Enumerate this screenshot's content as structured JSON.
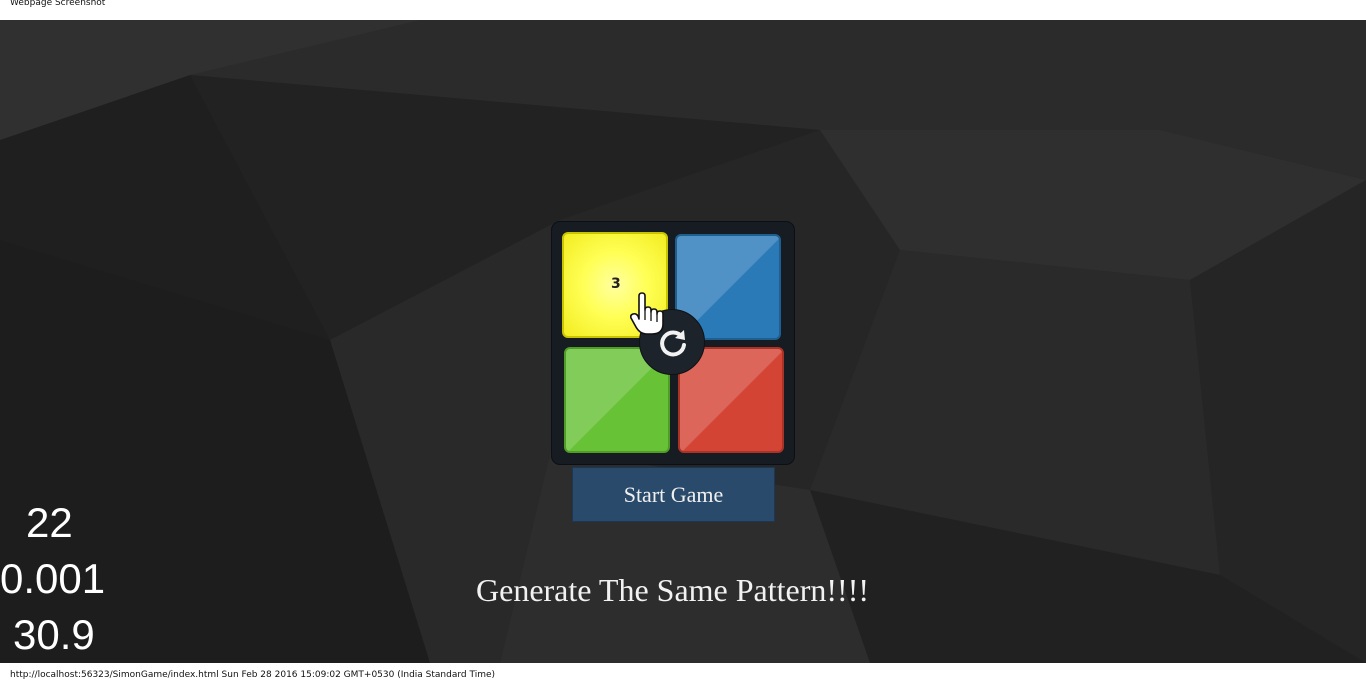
{
  "window": {
    "title": "Webpage Screenshot"
  },
  "game": {
    "pads": [
      {
        "color_name": "yellow",
        "color": "#ffff55",
        "active": true,
        "count": "3"
      },
      {
        "color_name": "blue",
        "color": "#2a7ab8",
        "active": false
      },
      {
        "color_name": "green",
        "color": "#67c235",
        "active": false
      },
      {
        "color_name": "red",
        "color": "#d34435",
        "active": false
      }
    ],
    "reset_icon": "refresh-icon",
    "cursor_icon": "hand-pointer-icon",
    "start_label": "Start Game",
    "tagline": "Generate The Same Pattern!!!!"
  },
  "stats": {
    "line1": "22",
    "line2": "0.001",
    "line3": "30.9"
  },
  "footer": {
    "text": "http://localhost:56323/SimonGame/index.html Sun Feb 28 2016 15:09:02 GMT+0530 (India Standard Time)"
  }
}
